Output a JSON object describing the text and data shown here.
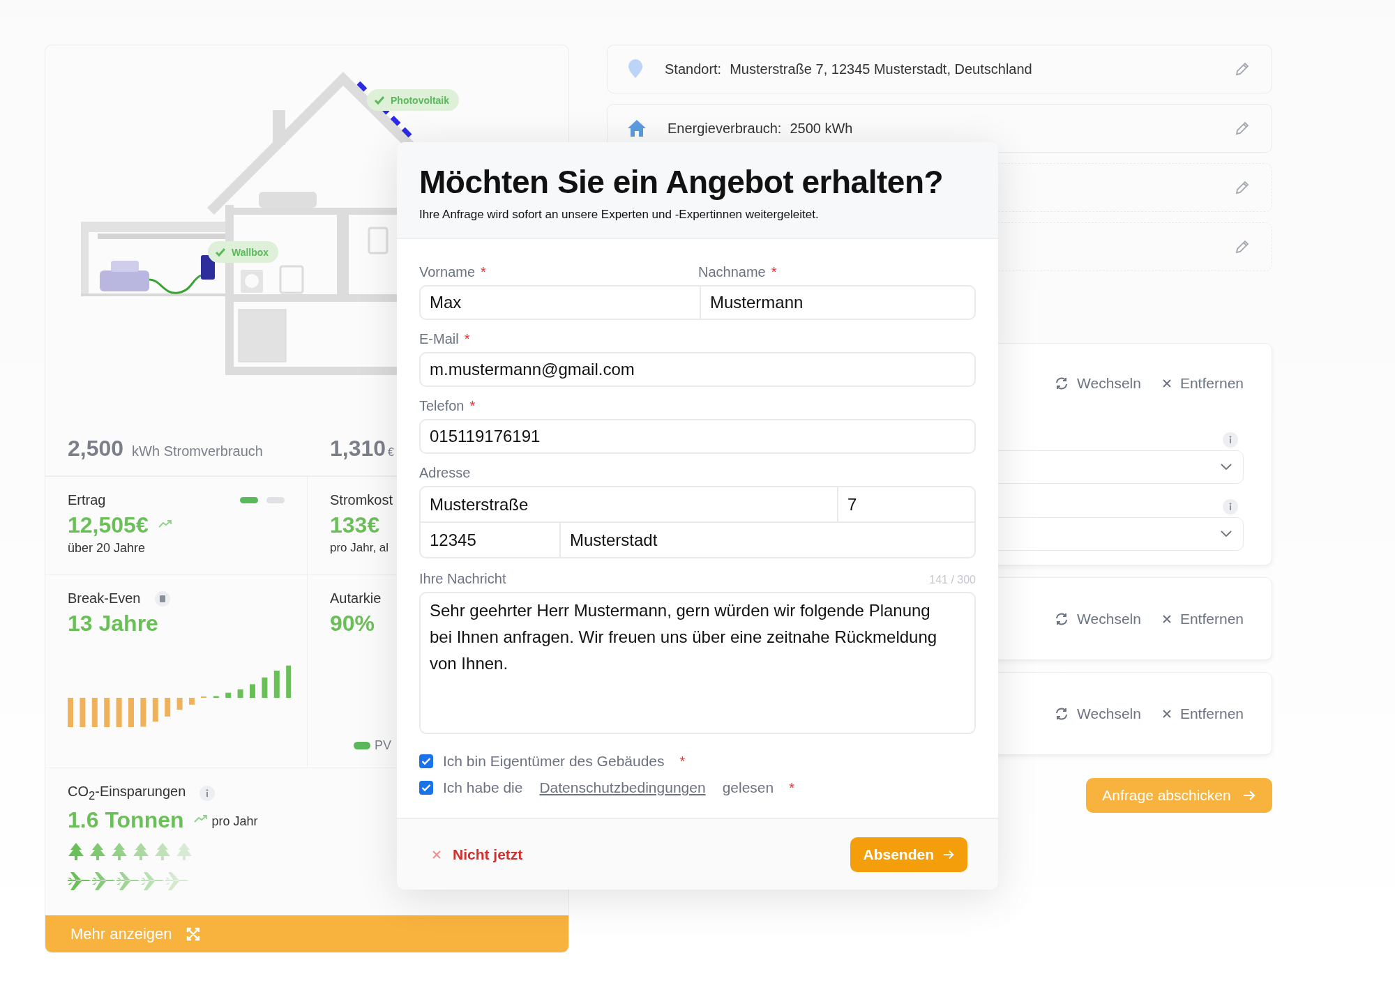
{
  "illustration": {
    "badges": [
      {
        "kind": "pv",
        "label": "Photovoltaik"
      },
      {
        "kind": "wallbox",
        "label": "Wallbox"
      }
    ]
  },
  "summary": [
    {
      "value": "2,500",
      "unit": "kWh Stromverbrauch"
    },
    {
      "value": "1,310",
      "unit": "€"
    }
  ],
  "ertrag": {
    "label": "Ertrag",
    "value": "12,505€",
    "note": "über 20 Jahre",
    "pager": [
      {
        "selected": true
      },
      {
        "selected": false
      }
    ]
  },
  "stromkosten": {
    "label": "Stromkost",
    "value": "133€",
    "note": "pro Jahr, al"
  },
  "break_even": {
    "label": "Break-Even",
    "value": "13 Jahre"
  },
  "autarkie": {
    "label": "Autarkie",
    "value": "90%",
    "legend": "PV"
  },
  "co2": {
    "label": "CO$_{2}$-Einsparungen",
    "value": "1.6 Tonnen",
    "note": "pro Jahr"
  },
  "more_button": "Mehr anzeigen",
  "info_rows": [
    {
      "kind": "location",
      "label": "Standort:",
      "value": "Musterstraße 7, 12345 Musterstadt, Deutschland"
    },
    {
      "kind": "energy",
      "label": "Energieverbrauch:",
      "value": "2500 kWh"
    },
    {
      "kind": "empty"
    },
    {
      "kind": "empty"
    }
  ],
  "products": [
    {
      "actions": [
        {
          "kind": "switch",
          "label": "Wechseln"
        },
        {
          "kind": "remove",
          "label": "Entfernen"
        }
      ],
      "dropdowns": [
        {
          "info": true
        },
        {
          "info": true
        }
      ]
    },
    {
      "actions": [
        {
          "kind": "switch",
          "label": "Wechseln"
        },
        {
          "kind": "remove",
          "label": "Entfernen"
        }
      ]
    },
    {
      "actions": [
        {
          "kind": "switch",
          "label": "Wechseln"
        },
        {
          "kind": "remove",
          "label": "Entfernen"
        }
      ]
    }
  ],
  "submit_button": "Anfrage abschicken",
  "dialog": {
    "title": "Möchten Sie ein Angebot erhalten?",
    "subtitle": "Ihre Anfrage wird sofort an unsere Experten und -Expertinnen weitergeleitet.",
    "first_name": {
      "label": "Vorname",
      "required": "*",
      "value": "Max"
    },
    "last_name": {
      "label": "Nachname",
      "required": "*",
      "value": "Mustermann"
    },
    "email": {
      "label": "E-Mail",
      "required": "*",
      "value": "m.mustermann@gmail.com"
    },
    "phone": {
      "label": "Telefon",
      "required": "*",
      "value": "015119176191"
    },
    "address": {
      "label": "Adresse",
      "street": "Musterstraße",
      "number": "7",
      "zip": "12345",
      "city": "Musterstadt"
    },
    "message": {
      "label": "Ihre Nachricht",
      "counter": "141 / 300",
      "value": "Sehr geehrter Herr Mustermann, gern würden wir folgende Planung bei Ihnen anfragen. Wir freuen uns über eine zeitnahe Rückmeldung von Ihnen."
    },
    "consents": [
      {
        "checked": true,
        "text": "Ich bin Eigentümer des Gebäudes",
        "required": "*"
      },
      {
        "checked": true,
        "text": "Ich habe die",
        "link": "Datenschutzbedingungen",
        "after": "gelesen",
        "required": "*"
      }
    ],
    "cancel": "Nicht jetzt",
    "submit": "Absenden"
  }
}
